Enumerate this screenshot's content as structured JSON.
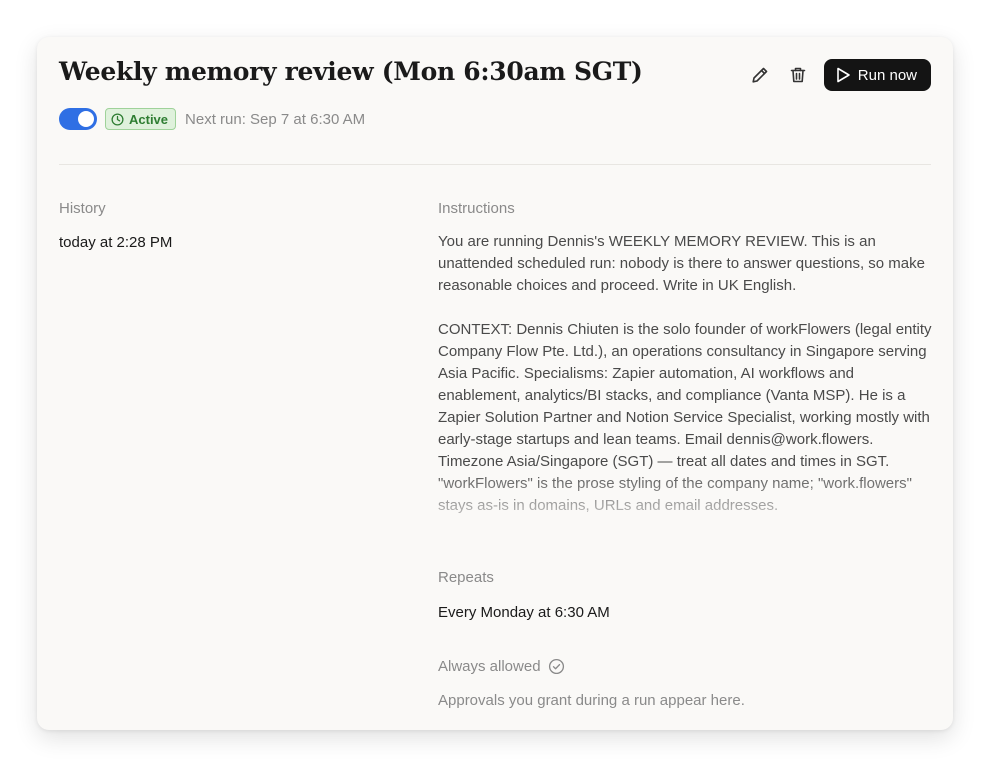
{
  "header": {
    "title": "Weekly memory review (Mon 6:30am SGT)",
    "run_now_label": "Run now"
  },
  "status": {
    "enabled": true,
    "badge_label": "Active",
    "next_run": "Next run: Sep 7 at 6:30 AM"
  },
  "history": {
    "label": "History",
    "entries": [
      "today at 2:28 PM"
    ]
  },
  "instructions": {
    "label": "Instructions",
    "paragraphs": [
      "You are running Dennis's WEEKLY MEMORY REVIEW. This is an unattended scheduled run: nobody is there to answer questions, so make reasonable choices and proceed. Write in UK English.",
      "CONTEXT: Dennis Chiuten is the solo founder of workFlowers (legal entity Company Flow Pte. Ltd.), an operations consultancy in Singapore serving Asia Pacific. Specialisms: Zapier automation, AI workflows and enablement, analytics/BI stacks, and compliance (Vanta MSP). He is a Zapier Solution Partner and Notion Service Specialist, working mostly with early-stage startups and lean teams. Email dennis@work.flowers. Timezone Asia/Singapore (SGT) — treat all dates and times in SGT. \"workFlowers\" is the prose styling of the company name; \"work.flowers\" stays as-is in domains, URLs and email addresses."
    ]
  },
  "repeats": {
    "label": "Repeats",
    "value": "Every Monday at 6:30 AM"
  },
  "always_allowed": {
    "label": "Always allowed",
    "empty_text": "Approvals you grant during a run appear here."
  },
  "colors": {
    "toggle": "#2f6fe4",
    "badge_bg": "#dff1dc",
    "badge_text": "#2e7d32",
    "run_button": "#141414"
  }
}
